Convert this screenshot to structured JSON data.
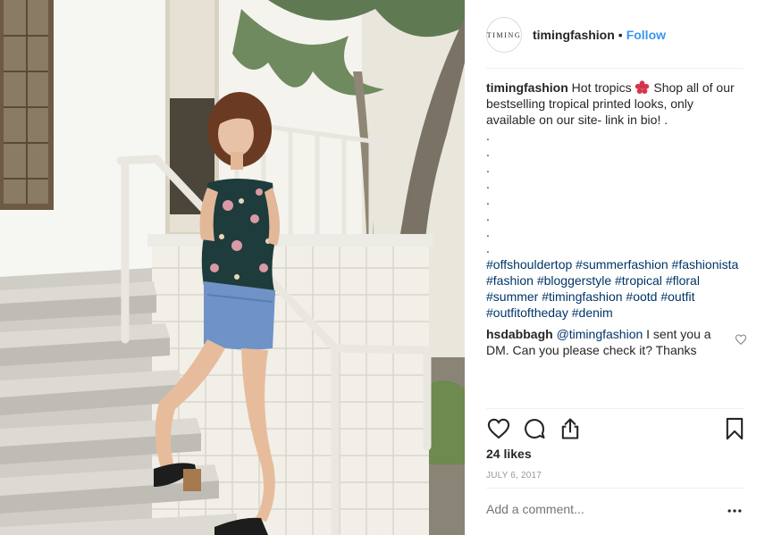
{
  "post": {
    "username": "timingfashion",
    "avatar_text": "TIMING",
    "separator": "•",
    "follow_label": "Follow",
    "caption": {
      "username": "timingfashion",
      "text_before": "Hot tropics",
      "emoji_icon": "hibiscus-icon",
      "text_after": "Shop all of our bestselling tropical printed looks, only available on our site- link in bio! .",
      "dots": [
        ".",
        ".",
        ".",
        ".",
        ".",
        ".",
        ".",
        "."
      ],
      "hashtags": [
        "#offshouldertop",
        "#summerfashion",
        "#fashionista",
        "#fashion",
        "#bloggerstyle",
        "#tropical",
        "#floral",
        "#summer",
        "#timingfashion",
        "#ootd",
        "#outfit",
        "#outfitoftheday",
        "#denim"
      ]
    },
    "comment": {
      "username": "hsdabbagh",
      "mention": "@timingfashion",
      "text": "I sent you a DM. Can you please check it? Thanks"
    },
    "actions": {
      "like_icon": "heart-icon",
      "comment_icon": "comment-bubble-icon",
      "share_icon": "share-icon",
      "save_icon": "bookmark-icon"
    },
    "likes": "24 likes",
    "date": "JULY 6, 2017",
    "add_comment_placeholder": "Add a comment...",
    "more_icon": "more-options-icon"
  },
  "colors": {
    "link_blue": "#3897f0",
    "hashtag_blue": "#003569",
    "text": "#262626",
    "muted": "#999999",
    "divider": "#efefef"
  }
}
